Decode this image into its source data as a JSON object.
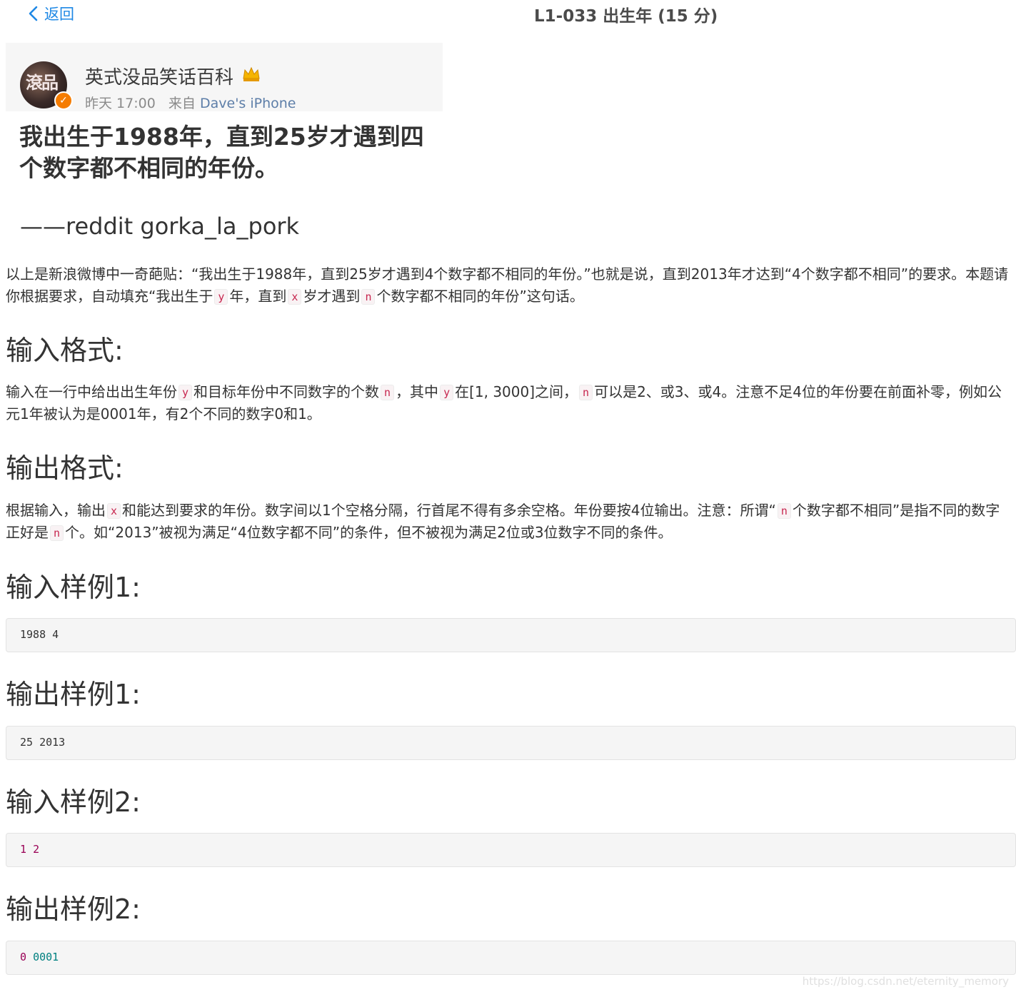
{
  "nav": {
    "back_label": "返回",
    "title": "L1-033 出生年 (15 分)"
  },
  "weibo_post": {
    "avatar_text": "滾品",
    "account_name": "英式没品笑话百科",
    "time": "昨天 17:00",
    "source_prefix": "来自",
    "source": "Dave's iPhone",
    "body": "我出生于1988年，直到25岁才遇到四个数字都不相同的年份。",
    "credit": "——reddit gorka_la_pork",
    "icons": [
      "verified-badge-icon",
      "crown-icon"
    ]
  },
  "description": {
    "intro_part1": "以上是新浪微博中一奇葩贴：“我出生于1988年，直到25岁才遇到4个数字都不相同的年份。”也就是说，直到2013年才达到“4个数字都不相同”的要求。本题请你根据要求，自动填充“我出生于",
    "code_y": "y",
    "intro_part2": "年，直到",
    "code_x": "x",
    "intro_part3": "岁才遇到",
    "code_n": "n",
    "intro_part4": "个数字都不相同的年份”这句话。"
  },
  "input_format": {
    "heading": "输入格式:",
    "part1": "输入在一行中给出出生年份",
    "code_y": "y",
    "part2": "和目标年份中不同数字的个数",
    "code_n": "n",
    "part3": "，其中",
    "code_y2": "y",
    "part4": "在[1, 3000]之间，",
    "code_n2": "n",
    "part5": "可以是2、或3、或4。注意不足4位的年份要在前面补零，例如公元1年被认为是0001年，有2个不同的数字0和1。"
  },
  "output_format": {
    "heading": "输出格式:",
    "part1": "根据输入，输出",
    "code_x": "x",
    "part2": "和能达到要求的年份。数字间以1个空格分隔，行首尾不得有多余空格。年份要按4位输出。注意：所谓“",
    "code_n": "n",
    "part3": "个数字都不相同”是指不同的数字正好是",
    "code_n2": "n",
    "part4": "个。如“2013”被视为满足“4位数字都不同”的条件，但不被视为满足2位或3位数字不同的条件。"
  },
  "samples": [
    {
      "heading": "输入样例1:",
      "a": "1988 4",
      "b": ""
    },
    {
      "heading": "输出样例1:",
      "a": "25 2013",
      "b": ""
    },
    {
      "heading": "输入样例2:",
      "a": "1",
      "b": "2"
    },
    {
      "heading": "输出样例2:",
      "a": "0",
      "b": "0001"
    }
  ],
  "watermark": "https://blog.csdn.net/eternity_memory",
  "colors": {
    "link": "#1e88e5",
    "inline_code": "#c7254e",
    "number_red": "#990055",
    "number_teal": "#008080"
  }
}
